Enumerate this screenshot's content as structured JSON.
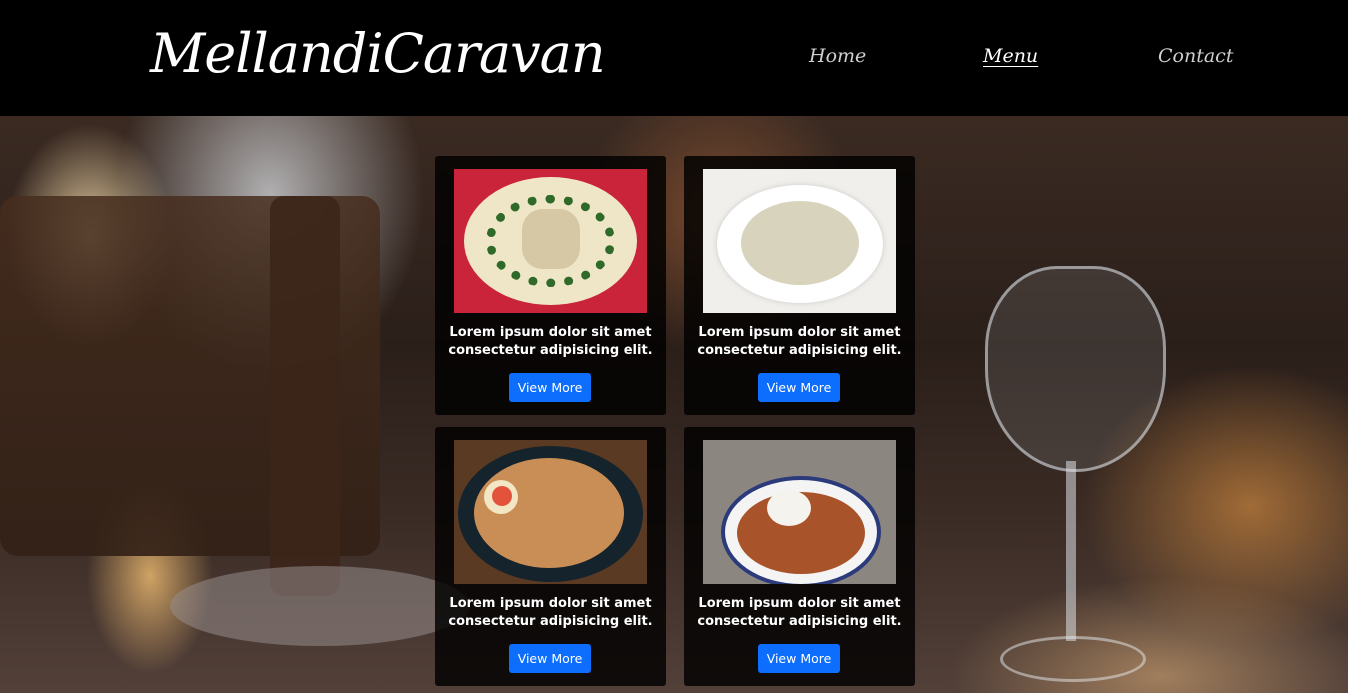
{
  "header": {
    "logo": "MellandiCaravan",
    "nav": [
      {
        "label": "Home",
        "active": false
      },
      {
        "label": "Menu",
        "active": true
      },
      {
        "label": "Contact",
        "active": false
      }
    ]
  },
  "menu_items": [
    {
      "description_line1": "Lorem ipsum dolor sit amet",
      "description_line2": "consectetur adipisicing elit.",
      "button": "View More",
      "image": "pasta-plate"
    },
    {
      "description_line1": "Lorem ipsum dolor sit amet",
      "description_line2": "consectetur adipisicing elit.",
      "button": "View More",
      "image": "clam-chowder"
    },
    {
      "description_line1": "Lorem ipsum dolor sit amet",
      "description_line2": "consectetur adipisicing elit.",
      "button": "View More",
      "image": "ramen-bowl"
    },
    {
      "description_line1": "Lorem ipsum dolor sit amet",
      "description_line2": "consectetur adipisicing elit.",
      "button": "View More",
      "image": "curry-bowl"
    }
  ],
  "colors": {
    "header_bg": "#000000",
    "button_bg": "#0d6efd",
    "card_bg": "rgba(0,0,0,0.82)"
  }
}
